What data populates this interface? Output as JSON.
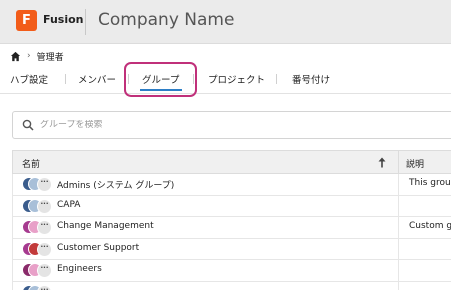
{
  "header": {
    "logo_letter": "F",
    "app_name": "Fusion",
    "company_name": "Company Name"
  },
  "breadcrumb": {
    "home_icon": "home-icon",
    "current": "管理者"
  },
  "tabs": [
    {
      "label": "ハブ設定"
    },
    {
      "label": "メンバー"
    },
    {
      "label": "グループ",
      "active": true
    },
    {
      "label": "プロジェクト"
    },
    {
      "label": "番号付け"
    }
  ],
  "search": {
    "placeholder": "グループを検索"
  },
  "table": {
    "columns": {
      "name": "名前",
      "description": "説明"
    },
    "rows": [
      {
        "name": "Admins (システム グループ)",
        "description": "This grou",
        "colors": [
          "#3a5c8c",
          "#a8bfd8"
        ]
      },
      {
        "name": "CAPA",
        "description": "",
        "colors": [
          "#3a5c8c",
          "#a8bfd8"
        ]
      },
      {
        "name": "Change Management",
        "description": "Custom g",
        "colors": [
          "#a63a8f",
          "#e8a0c8"
        ]
      },
      {
        "name": "Customer Support",
        "description": "",
        "colors": [
          "#a63a8f",
          "#c23a3a"
        ]
      },
      {
        "name": "Engineers",
        "description": "",
        "colors": [
          "#8a2a6a",
          "#e8a0c8"
        ]
      },
      {
        "name": "",
        "description": "",
        "colors": [
          "#3a5c8c",
          "#a8bfd8"
        ]
      }
    ]
  },
  "colors": {
    "logo": "#f25c19",
    "highlight": "#c0307a",
    "active_tab": "#2d7ec6"
  }
}
